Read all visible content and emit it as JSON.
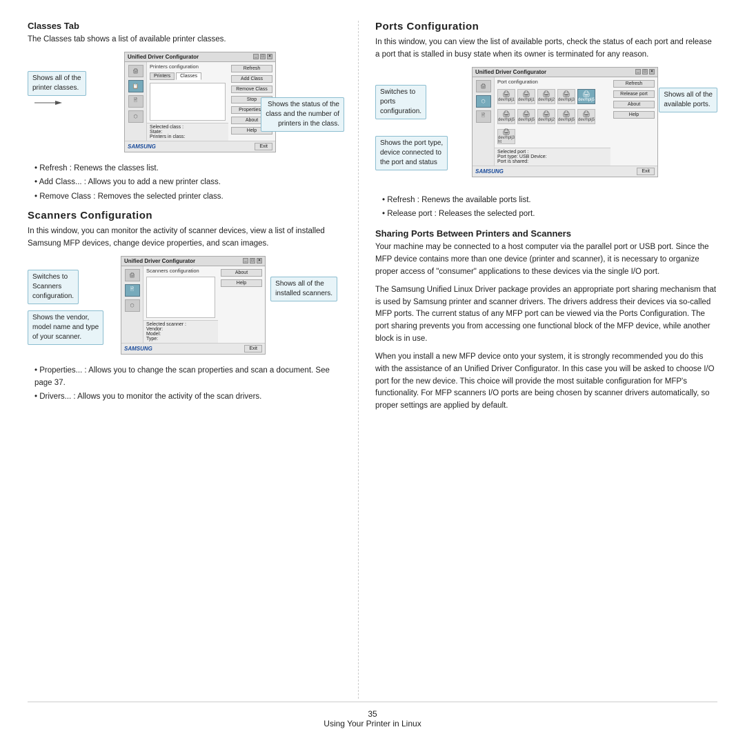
{
  "page": {
    "number": "35",
    "footer_text": "Using Your Printer in Linux"
  },
  "left_col": {
    "classes_tab": {
      "title": "Classes Tab",
      "body": "The Classes tab shows a list of available printer classes.",
      "screenshot": {
        "titlebar": "Unified Driver Configurator",
        "section_label": "Printers configuration",
        "tabs": [
          "Printers",
          "Classes"
        ],
        "buttons": [
          "Refresh",
          "Add Class",
          "Remove Class",
          "Stop",
          "Properties...",
          "About",
          "Help"
        ],
        "list_items": [],
        "status_label": "Selected class :",
        "status_fields": [
          "State:",
          "Printers in class:"
        ]
      },
      "callouts": [
        {
          "text": "Shows all of the printer classes."
        },
        {
          "text": "Shows the status of the class and the number of printers in the class."
        }
      ],
      "bullets": [
        "Refresh : Renews the classes list.",
        "Add Class... : Allows you to add a new printer class.",
        "Remove Class : Removes the selected printer class."
      ]
    },
    "scanners": {
      "title": "Scanners Configuration",
      "body": "In this window, you can monitor the activity of scanner devices, view a list of installed Samsung MFP devices, change device properties, and scan images.",
      "screenshot": {
        "titlebar": "Unified Driver Configurator",
        "section_label": "Scanners configuration",
        "buttons": [
          "About",
          "Help"
        ],
        "list_items": [],
        "status_label": "Selected scanner :",
        "status_fields": [
          "Vendor:",
          "Model:",
          "Type:"
        ]
      },
      "callouts": [
        {
          "text": "Switches to Scanners configuration."
        },
        {
          "text": "Shows all of the installed scanners."
        },
        {
          "text": "Shows the vendor, model name and type of your scanner."
        }
      ],
      "bullets": [
        "Properties... : Allows you to change the scan properties and scan a document. See page 37.",
        "Drivers... : Allows you to monitor the activity of the scan drivers."
      ]
    }
  },
  "right_col": {
    "ports": {
      "title": "Ports Configuration",
      "body": "In this window, you can view the list of available ports, check the status of each port and release a port that is stalled in busy state when its owner is terminated for any reason.",
      "screenshot": {
        "titlebar": "Unified Driver Configurator",
        "section_label": "Port configuration",
        "buttons": [
          "Refresh",
          "Release port",
          "About",
          "Help"
        ],
        "icon_rows": [
          [
            "dev/hplj1",
            "dev/hplj1",
            "dev/hplj2",
            "dev/hplj3",
            "dev/hplj5"
          ],
          [
            "dev/hplj5",
            "dev/hplj5",
            "dev/hplj2",
            "dev/hplj5",
            "dev/hplj5"
          ]
        ],
        "status_label": "Selected port :",
        "status_fields": [
          "Port type: USB  Device:",
          "Port is shared:"
        ]
      },
      "callouts": [
        {
          "text": "Switches to ports configuration."
        },
        {
          "text": "Shows all of the available ports."
        },
        {
          "text": "Shows the port type, device connected to the port and status"
        }
      ],
      "bullets": [
        "Refresh : Renews the available ports list.",
        "Release port : Releases the selected port."
      ]
    },
    "sharing": {
      "title": "Sharing Ports Between Printers and Scanners",
      "paragraphs": [
        "Your machine may be connected to a host computer via the parallel port or USB port. Since the MFP device contains more than one device (printer and scanner), it is necessary to organize proper access of \"consumer\" applications to these devices via the single I/O port.",
        "The Samsung Unified Linux Driver package provides an appropriate port sharing mechanism that is used by Samsung printer and scanner drivers. The drivers address their devices via so-called MFP ports. The current status of any MFP port can be viewed via the Ports Configuration. The port sharing prevents you from accessing one functional block of the MFP device, while another block is in use.",
        "When you install a new MFP device onto your system, it is strongly recommended you do this with the assistance of an Unified Driver Configurator. In this case you will be asked to choose I/O port for the new device. This choice will provide the most suitable configuration for MFP's functionality. For MFP scanners I/O ports are being chosen by scanner drivers automatically, so proper settings are applied by default."
      ]
    }
  }
}
